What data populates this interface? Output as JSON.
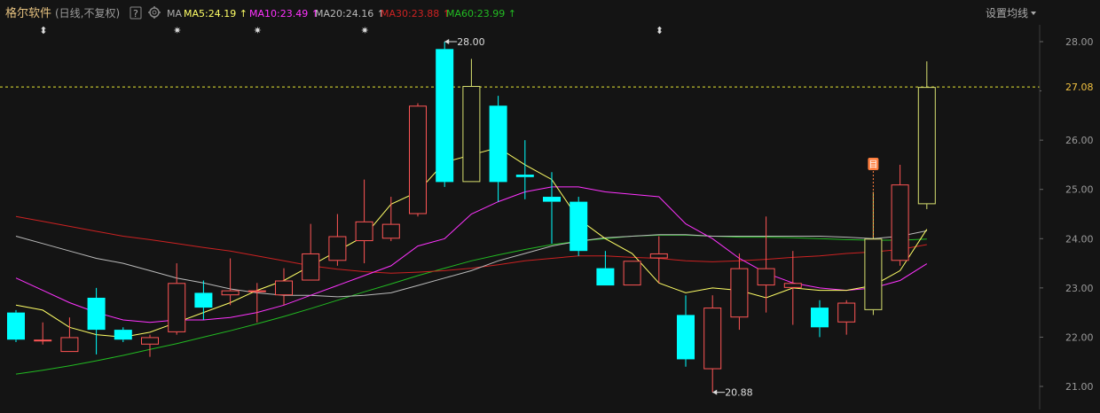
{
  "header": {
    "stock_name": "格尔软件",
    "period_label": "(日线,不复权)",
    "help_label": "?",
    "ma_label": "MA",
    "settings_label": "设置均线",
    "ma_items": [
      {
        "label": "MA5:24.19",
        "color": "#ffff66",
        "arrow": "↑"
      },
      {
        "label": "MA10:23.49",
        "color": "#ff33ff",
        "arrow": "↑"
      },
      {
        "label": "MA20:24.16",
        "color": "#bbbbbb",
        "arrow": "↑"
      },
      {
        "label": "MA30:23.88",
        "color": "#cc2222",
        "arrow": "↑"
      },
      {
        "label": "MA60:23.99",
        "color": "#22bb22",
        "arrow": "↑"
      }
    ]
  },
  "chart_data": {
    "type": "candlestick",
    "ylim": [
      20.75,
      28.3
    ],
    "yticks": [
      "28.00",
      "27.00",
      "26.00",
      "25.00",
      "24.00",
      "23.00",
      "22.00",
      "21.00"
    ],
    "ytick_values": [
      28,
      27,
      26,
      25,
      24,
      23,
      22,
      21
    ],
    "current_price": 27.08,
    "current_price_label": "27.08",
    "high_label": "28.00",
    "low_label": "20.88",
    "colors": {
      "up": "#ff5555",
      "down": "#00ffff",
      "ma5": "#ffff66",
      "ma10": "#ff33ff",
      "ma20": "#bbbbbb",
      "ma30": "#cc2222",
      "ma60": "#22bb22",
      "event": "#ff7f3f",
      "price_line": "#e5e533"
    },
    "candles": [
      {
        "o": 22.5,
        "h": 22.55,
        "c": 21.95,
        "l": 21.9
      },
      {
        "o": 21.95,
        "h": 22.3,
        "c": 21.95,
        "l": 21.85
      },
      {
        "o": 21.7,
        "h": 22.4,
        "c": 22.0,
        "l": 21.7
      },
      {
        "o": 22.8,
        "h": 23.0,
        "c": 22.15,
        "l": 21.65
      },
      {
        "o": 22.15,
        "h": 22.2,
        "c": 21.95,
        "l": 21.9
      },
      {
        "o": 21.85,
        "h": 22.05,
        "c": 22.0,
        "l": 21.6
      },
      {
        "o": 22.1,
        "h": 23.5,
        "c": 23.1,
        "l": 22.05
      },
      {
        "o": 22.9,
        "h": 23.15,
        "c": 22.6,
        "l": 22.35
      },
      {
        "o": 22.85,
        "h": 23.6,
        "c": 22.95,
        "l": 22.65
      },
      {
        "o": 22.95,
        "h": 23.1,
        "c": 22.95,
        "l": 22.3
      },
      {
        "o": 22.85,
        "h": 23.4,
        "c": 23.15,
        "l": 22.65
      },
      {
        "o": 23.15,
        "h": 24.3,
        "c": 23.7,
        "l": 23.15
      },
      {
        "o": 23.55,
        "h": 24.5,
        "c": 24.05,
        "l": 23.45
      },
      {
        "o": 23.95,
        "h": 25.2,
        "c": 24.35,
        "l": 23.5
      },
      {
        "o": 24.0,
        "h": 24.85,
        "c": 24.3,
        "l": 23.95
      },
      {
        "o": 24.5,
        "h": 26.75,
        "c": 26.7,
        "l": 24.45
      },
      {
        "o": 27.85,
        "h": 28.0,
        "c": 25.15,
        "l": 25.05
      },
      {
        "o": 25.15,
        "h": 27.65,
        "c": 27.1,
        "l": 25.15
      },
      {
        "o": 26.7,
        "h": 26.9,
        "c": 25.15,
        "l": 24.75
      },
      {
        "o": 25.3,
        "h": 26.0,
        "c": 25.25,
        "l": 24.8
      },
      {
        "o": 24.85,
        "h": 25.35,
        "c": 24.75,
        "l": 23.9
      },
      {
        "o": 24.75,
        "h": 24.85,
        "c": 23.75,
        "l": 23.65
      },
      {
        "o": 23.4,
        "h": 23.75,
        "c": 23.05,
        "l": 23.05
      },
      {
        "o": 23.05,
        "h": 23.55,
        "c": 23.55,
        "l": 23.05
      },
      {
        "o": 23.6,
        "h": 24.05,
        "c": 23.7,
        "l": 23.1
      },
      {
        "o": 22.45,
        "h": 22.85,
        "c": 21.55,
        "l": 21.4
      },
      {
        "o": 21.35,
        "h": 22.85,
        "c": 22.6,
        "l": 20.88
      },
      {
        "o": 22.4,
        "h": 23.7,
        "c": 23.4,
        "l": 22.15
      },
      {
        "o": 23.05,
        "h": 24.45,
        "c": 23.4,
        "l": 22.5
      },
      {
        "o": 23.0,
        "h": 23.75,
        "c": 23.1,
        "l": 22.25
      },
      {
        "o": 22.6,
        "h": 22.75,
        "c": 22.2,
        "l": 22.0
      },
      {
        "o": 22.3,
        "h": 22.75,
        "c": 22.7,
        "l": 22.05
      },
      {
        "o": 22.55,
        "h": 24.95,
        "c": 24.0,
        "l": 22.45
      },
      {
        "o": 23.55,
        "h": 25.5,
        "c": 25.1,
        "l": 23.45
      },
      {
        "o": 24.7,
        "h": 27.6,
        "c": 27.08,
        "l": 24.6
      }
    ],
    "ma5": [
      22.65,
      22.55,
      22.2,
      22.05,
      22.0,
      22.1,
      22.3,
      22.5,
      22.7,
      22.95,
      23.15,
      23.45,
      23.75,
      24.05,
      24.7,
      24.95,
      25.55,
      25.7,
      25.85,
      25.5,
      25.2,
      24.4,
      24.0,
      23.7,
      23.1,
      22.9,
      23.0,
      22.95,
      22.8,
      23.0,
      22.95,
      22.95,
      23.05,
      23.35,
      24.19
    ],
    "ma10": [
      23.2,
      22.95,
      22.7,
      22.5,
      22.35,
      22.3,
      22.35,
      22.35,
      22.4,
      22.5,
      22.65,
      22.85,
      23.05,
      23.25,
      23.45,
      23.85,
      24.0,
      24.5,
      24.75,
      24.95,
      25.05,
      25.05,
      24.95,
      24.9,
      24.85,
      24.3,
      24.0,
      23.6,
      23.3,
      23.1,
      23.0,
      22.95,
      23.0,
      23.15,
      23.49
    ],
    "ma20": [
      24.05,
      23.9,
      23.75,
      23.6,
      23.5,
      23.35,
      23.2,
      23.1,
      22.98,
      22.9,
      22.85,
      22.85,
      22.82,
      22.85,
      22.9,
      23.05,
      23.2,
      23.35,
      23.55,
      23.7,
      23.85,
      23.95,
      24.02,
      24.05,
      24.08,
      24.08,
      24.05,
      24.05,
      24.05,
      24.05,
      24.05,
      24.03,
      24.0,
      24.05,
      24.16
    ],
    "ma30": [
      24.45,
      24.35,
      24.25,
      24.15,
      24.05,
      23.98,
      23.9,
      23.82,
      23.75,
      23.65,
      23.55,
      23.45,
      23.38,
      23.33,
      23.3,
      23.32,
      23.35,
      23.4,
      23.47,
      23.55,
      23.6,
      23.65,
      23.65,
      23.62,
      23.6,
      23.55,
      23.53,
      23.55,
      23.58,
      23.62,
      23.65,
      23.7,
      23.73,
      23.78,
      23.88
    ],
    "ma60": [
      21.25,
      21.33,
      21.42,
      21.52,
      21.63,
      21.75,
      21.87,
      22.0,
      22.13,
      22.27,
      22.42,
      22.58,
      22.75,
      22.92,
      23.08,
      23.25,
      23.4,
      23.55,
      23.67,
      23.78,
      23.88,
      23.95,
      24.0,
      24.05,
      24.07,
      24.07,
      24.05,
      24.03,
      24.03,
      24.02,
      24.0,
      23.98,
      23.97,
      23.97,
      23.99
    ],
    "event_markers": [
      {
        "index": 1,
        "symbol": "⬍"
      },
      {
        "index": 6,
        "symbol": "✷"
      },
      {
        "index": 9,
        "symbol": "✷"
      },
      {
        "index": 13,
        "symbol": "✷"
      },
      {
        "index": 24,
        "symbol": "⬍"
      }
    ],
    "info_badge": {
      "index": 32,
      "label": "目"
    }
  }
}
